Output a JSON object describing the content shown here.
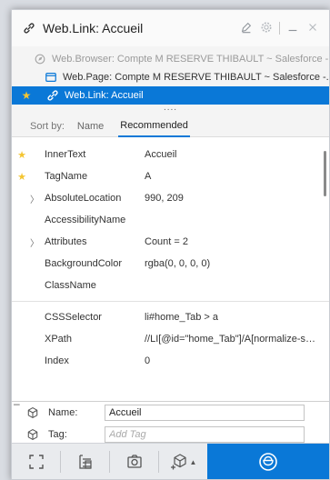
{
  "window": {
    "title": "Web.Link: Accueil"
  },
  "tree": {
    "items": [
      {
        "label": "Web.Browser: Compte M RESERVE THIBAULT ~ Salesforce -..."
      },
      {
        "label": "Web.Page: Compte M RESERVE THIBAULT ~ Salesforce -..."
      },
      {
        "label": "Web.Link: Accueil"
      }
    ],
    "more": "...."
  },
  "sort": {
    "label": "Sort by:",
    "options": [
      "Name",
      "Recommended"
    ],
    "active": "Recommended"
  },
  "properties": [
    {
      "name": "InnerText",
      "value": "Accueil",
      "starred": true,
      "expandable": false
    },
    {
      "name": "TagName",
      "value": "A",
      "starred": true,
      "expandable": false
    },
    {
      "name": "AbsoluteLocation",
      "value": "990, 209",
      "starred": false,
      "expandable": true
    },
    {
      "name": "AccessibilityName",
      "value": "",
      "starred": false,
      "expandable": false
    },
    {
      "name": "Attributes",
      "value": "Count = 2",
      "starred": false,
      "expandable": true
    },
    {
      "name": "BackgroundColor",
      "value": "rgba(0, 0, 0, 0)",
      "starred": false,
      "expandable": false
    },
    {
      "name": "ClassName",
      "value": "",
      "starred": false,
      "expandable": false
    },
    {
      "name": "CSSSelector",
      "value": "li#home_Tab > a",
      "starred": false,
      "expandable": false
    },
    {
      "name": "XPath",
      "value": "//LI[@id=\"home_Tab\"]/A[normalize-space...",
      "starred": false,
      "expandable": false
    },
    {
      "name": "Index",
      "value": "0",
      "starred": false,
      "expandable": false
    }
  ],
  "details": {
    "collapse": "–",
    "name_label": "Name:",
    "name_value": "Accueil",
    "tag_label": "Tag:",
    "tag_placeholder": "Add Tag"
  },
  "colors": {
    "accent": "#0a78d7",
    "star": "#f4c531"
  }
}
